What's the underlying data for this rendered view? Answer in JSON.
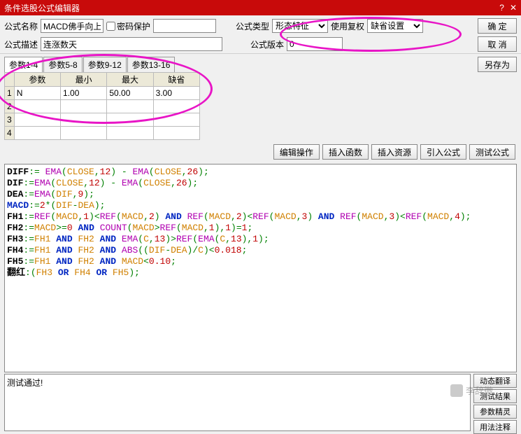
{
  "window": {
    "title": "条件选股公式编辑器"
  },
  "labels": {
    "name": "公式名称",
    "desc": "公式描述",
    "pwd": "密码保护",
    "type": "公式类型",
    "usefuquan": "使用复权",
    "version": "公式版本"
  },
  "fields": {
    "name": "MACD佛手向上",
    "desc": "连涨数天",
    "pwd": "",
    "type": "形态特征",
    "fuquan": "缺省设置",
    "version": "0"
  },
  "buttons": {
    "ok": "确  定",
    "cancel": "取  消",
    "saveas": "另存为",
    "edit_ops": "编辑操作",
    "insert_fn": "插入函数",
    "insert_res": "插入资源",
    "import": "引入公式",
    "test": "测试公式",
    "dyn_trans": "动态翻译",
    "test_result": "测试结果",
    "param_wizard": "参数精灵",
    "usage_note": "用法注释"
  },
  "tabs": [
    "参数1-4",
    "参数5-8",
    "参数9-12",
    "参数13-16"
  ],
  "param_headers": [
    "参数",
    "最小",
    "最大",
    "缺省"
  ],
  "params": [
    {
      "name": "N",
      "min": "1.00",
      "max": "50.00",
      "def": "3.00"
    },
    {
      "name": "",
      "min": "",
      "max": "",
      "def": ""
    },
    {
      "name": "",
      "min": "",
      "max": "",
      "def": ""
    },
    {
      "name": "",
      "min": "",
      "max": "",
      "def": ""
    }
  ],
  "status": "测试通过!",
  "watermark": "李辞微",
  "code_lines": [
    [
      [
        "def",
        "DIFF"
      ],
      [
        "op",
        ":= "
      ],
      [
        "fn",
        "EMA"
      ],
      [
        "op",
        "("
      ],
      [
        "var",
        "CLOSE"
      ],
      [
        "op",
        ","
      ],
      [
        "num",
        "12"
      ],
      [
        "op",
        ") - "
      ],
      [
        "fn",
        "EMA"
      ],
      [
        "op",
        "("
      ],
      [
        "var",
        "CLOSE"
      ],
      [
        "op",
        ","
      ],
      [
        "num",
        "26"
      ],
      [
        "op",
        ");"
      ]
    ],
    [
      [
        "def",
        "DIF"
      ],
      [
        "op",
        ":="
      ],
      [
        "fn",
        "EMA"
      ],
      [
        "op",
        "("
      ],
      [
        "var",
        "CLOSE"
      ],
      [
        "op",
        ","
      ],
      [
        "num",
        "12"
      ],
      [
        "op",
        ") - "
      ],
      [
        "fn",
        "EMA"
      ],
      [
        "op",
        "("
      ],
      [
        "var",
        "CLOSE"
      ],
      [
        "op",
        ","
      ],
      [
        "num",
        "26"
      ],
      [
        "op",
        ");"
      ]
    ],
    [
      [
        "def",
        "DEA"
      ],
      [
        "op",
        ":="
      ],
      [
        "fn",
        "EMA"
      ],
      [
        "op",
        "("
      ],
      [
        "var",
        "DIF"
      ],
      [
        "op",
        ","
      ],
      [
        "num",
        "9"
      ],
      [
        "op",
        ");"
      ]
    ],
    [
      [
        "kw",
        "MACD"
      ],
      [
        "op",
        ":="
      ],
      [
        "num",
        "2"
      ],
      [
        "op",
        "*("
      ],
      [
        "var",
        "DIF"
      ],
      [
        "op",
        "-"
      ],
      [
        "var",
        "DEA"
      ],
      [
        "op",
        ");"
      ]
    ],
    [
      [
        "def",
        "FH1"
      ],
      [
        "op",
        ":="
      ],
      [
        "fn",
        "REF"
      ],
      [
        "op",
        "("
      ],
      [
        "var",
        "MACD"
      ],
      [
        "op",
        ","
      ],
      [
        "num",
        "1"
      ],
      [
        "op",
        ")<"
      ],
      [
        "fn",
        "REF"
      ],
      [
        "op",
        "("
      ],
      [
        "var",
        "MACD"
      ],
      [
        "op",
        ","
      ],
      [
        "num",
        "2"
      ],
      [
        "op",
        ") "
      ],
      [
        "kw",
        "AND"
      ],
      [
        "op",
        " "
      ],
      [
        "fn",
        "REF"
      ],
      [
        "op",
        "("
      ],
      [
        "var",
        "MACD"
      ],
      [
        "op",
        ","
      ],
      [
        "num",
        "2"
      ],
      [
        "op",
        ")<"
      ],
      [
        "fn",
        "REF"
      ],
      [
        "op",
        "("
      ],
      [
        "var",
        "MACD"
      ],
      [
        "op",
        ","
      ],
      [
        "num",
        "3"
      ],
      [
        "op",
        ") "
      ],
      [
        "kw",
        "AND"
      ],
      [
        "op",
        " "
      ],
      [
        "fn",
        "REF"
      ],
      [
        "op",
        "("
      ],
      [
        "var",
        "MACD"
      ],
      [
        "op",
        ","
      ],
      [
        "num",
        "3"
      ],
      [
        "op",
        ")<"
      ],
      [
        "fn",
        "REF"
      ],
      [
        "op",
        "("
      ],
      [
        "var",
        "MACD"
      ],
      [
        "op",
        ","
      ],
      [
        "num",
        "4"
      ],
      [
        "op",
        ");"
      ]
    ],
    [
      [
        "def",
        "FH2"
      ],
      [
        "op",
        ":="
      ],
      [
        "var",
        "MACD"
      ],
      [
        "op",
        ">="
      ],
      [
        "num",
        "0"
      ],
      [
        "op",
        " "
      ],
      [
        "kw",
        "AND"
      ],
      [
        "op",
        " "
      ],
      [
        "fn",
        "COUNT"
      ],
      [
        "op",
        "("
      ],
      [
        "var",
        "MACD"
      ],
      [
        "op",
        ">"
      ],
      [
        "fn",
        "REF"
      ],
      [
        "op",
        "("
      ],
      [
        "var",
        "MACD"
      ],
      [
        "op",
        ","
      ],
      [
        "num",
        "1"
      ],
      [
        "op",
        "),"
      ],
      [
        "num",
        "1"
      ],
      [
        "op",
        ")="
      ],
      [
        "num",
        "1"
      ],
      [
        "op",
        ";"
      ]
    ],
    [
      [
        "def",
        "FH3"
      ],
      [
        "op",
        ":="
      ],
      [
        "var",
        "FH1"
      ],
      [
        "op",
        " "
      ],
      [
        "kw",
        "AND"
      ],
      [
        "op",
        " "
      ],
      [
        "var",
        "FH2"
      ],
      [
        "op",
        " "
      ],
      [
        "kw",
        "AND"
      ],
      [
        "op",
        " "
      ],
      [
        "fn",
        "EMA"
      ],
      [
        "op",
        "("
      ],
      [
        "var",
        "C"
      ],
      [
        "op",
        ","
      ],
      [
        "num",
        "13"
      ],
      [
        "op",
        ")>"
      ],
      [
        "fn",
        "REF"
      ],
      [
        "op",
        "("
      ],
      [
        "fn",
        "EMA"
      ],
      [
        "op",
        "("
      ],
      [
        "var",
        "C"
      ],
      [
        "op",
        ","
      ],
      [
        "num",
        "13"
      ],
      [
        "op",
        "),"
      ],
      [
        "num",
        "1"
      ],
      [
        "op",
        ");"
      ]
    ],
    [
      [
        "def",
        "FH4"
      ],
      [
        "op",
        ":="
      ],
      [
        "var",
        "FH1"
      ],
      [
        "op",
        " "
      ],
      [
        "kw",
        "AND"
      ],
      [
        "op",
        " "
      ],
      [
        "var",
        "FH2"
      ],
      [
        "op",
        " "
      ],
      [
        "kw",
        "AND"
      ],
      [
        "op",
        " "
      ],
      [
        "fn",
        "ABS"
      ],
      [
        "op",
        "(("
      ],
      [
        "var",
        "DIF"
      ],
      [
        "op",
        "-"
      ],
      [
        "var",
        "DEA"
      ],
      [
        "op",
        ")/"
      ],
      [
        "var",
        "C"
      ],
      [
        "op",
        ")<"
      ],
      [
        "num",
        "0.018"
      ],
      [
        "op",
        ";"
      ]
    ],
    [
      [
        "def",
        "FH5"
      ],
      [
        "op",
        ":="
      ],
      [
        "var",
        "FH1"
      ],
      [
        "op",
        " "
      ],
      [
        "kw",
        "AND"
      ],
      [
        "op",
        " "
      ],
      [
        "var",
        "FH2"
      ],
      [
        "op",
        " "
      ],
      [
        "kw",
        "AND"
      ],
      [
        "op",
        " "
      ],
      [
        "var",
        "MACD"
      ],
      [
        "op",
        "<"
      ],
      [
        "num",
        "0.10"
      ],
      [
        "op",
        ";"
      ]
    ],
    [
      [
        "def",
        "翻红"
      ],
      [
        "op",
        ":("
      ],
      [
        "var",
        "FH3"
      ],
      [
        "op",
        " "
      ],
      [
        "kw",
        "OR"
      ],
      [
        "op",
        " "
      ],
      [
        "var",
        "FH4"
      ],
      [
        "op",
        " "
      ],
      [
        "kw",
        "OR"
      ],
      [
        "op",
        " "
      ],
      [
        "var",
        "FH5"
      ],
      [
        "op",
        ");"
      ]
    ]
  ]
}
